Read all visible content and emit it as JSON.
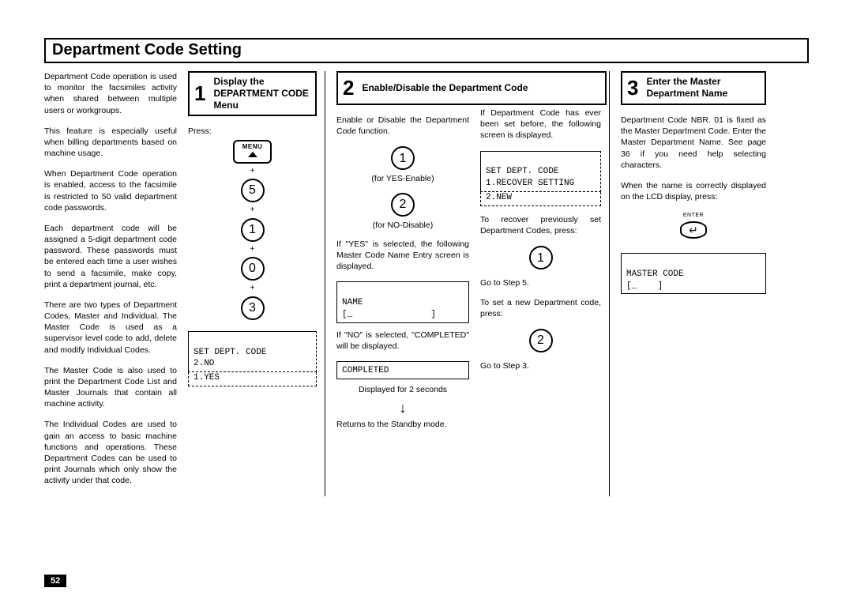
{
  "title": "Department Code Setting",
  "page_number": "52",
  "intro": {
    "p1": "Department Code operation is used to monitor the facsimiles activity when shared between multiple users or workgroups.",
    "p2": "This feature is especially useful when billing departments based on machine usage.",
    "p3": "When Department Code operation is enabled, access to the facsimile is restricted to 50 valid department code passwords.",
    "p4": "Each department code will be assigned a 5-digit department code password. These passwords must be entered each time a user wishes to send a facsimile, make copy, print a department journal, etc.",
    "p5": "There are two types of Department Codes, Master and Individual. The Master Code is used as a supervisor level code to add, delete and modify Individual Codes.",
    "p6": "The Master Code is also used to print the Department Code List and Master Journals that contain all machine activity.",
    "p7": "The Individual Codes are used to gain an access to basic machine functions and operations. These Department Codes can be used to print Journals which only show the activity under that code."
  },
  "step1": {
    "num": "1",
    "title_line1": "Display the",
    "title_line2": "DEPARTMENT CODE",
    "title_line3": "Menu",
    "press": "Press:",
    "menu_key": "MENU",
    "digits": [
      "5",
      "1",
      "0",
      "3"
    ],
    "lcd_line1": "SET DEPT. CODE",
    "lcd_line2": "2.NO",
    "lcd_line3_dashed": "1.YES"
  },
  "step2": {
    "num": "2",
    "title": "Enable/Disable the Department Code",
    "intro": "Enable or Disable the Department Code function.",
    "b1": "1",
    "b1_note": "(for YES-Enable)",
    "b2": "2",
    "b2_note": "(for NO-Disable)",
    "yes_txt": "If \"YES\" is selected, the following Master Code Name Entry screen is displayed.",
    "lcd_name_l1": "NAME",
    "lcd_name_l2": "[_               ]",
    "no_txt": "If \"NO\" is selected, \"COMPLETED\" will be displayed.",
    "lcd_completed": "COMPLETED",
    "completed_note": "Displayed for 2 seconds",
    "return_txt": "Returns to the Standby mode.",
    "col3_intro": "If Department Code has ever been set before, the following screen is displayed.",
    "lcd_set_l1": "SET DEPT. CODE",
    "lcd_set_l2": "1.RECOVER SETTING",
    "lcd_set_l3": "2.NEW",
    "recover_txt": "To recover previously set Department Codes, press:",
    "b_recover": "1",
    "goto5": "Go to Step 5.",
    "new_txt": "To set a new Department code, press:",
    "b_new": "2",
    "goto3": "Go to Step 3."
  },
  "step3": {
    "num": "3",
    "title_line1": "Enter the Master",
    "title_line2": "Department Name",
    "p1": "Department Code NBR. 01 is fixed as the Master Department Code. Enter the Master Department Name. See page 36 if you need help selecting characters.",
    "p2": "When the name is correctly displayed on the LCD display, press:",
    "enter_label": "ENTER",
    "lcd_l1": "MASTER CODE",
    "lcd_l2": "[_    ]"
  }
}
